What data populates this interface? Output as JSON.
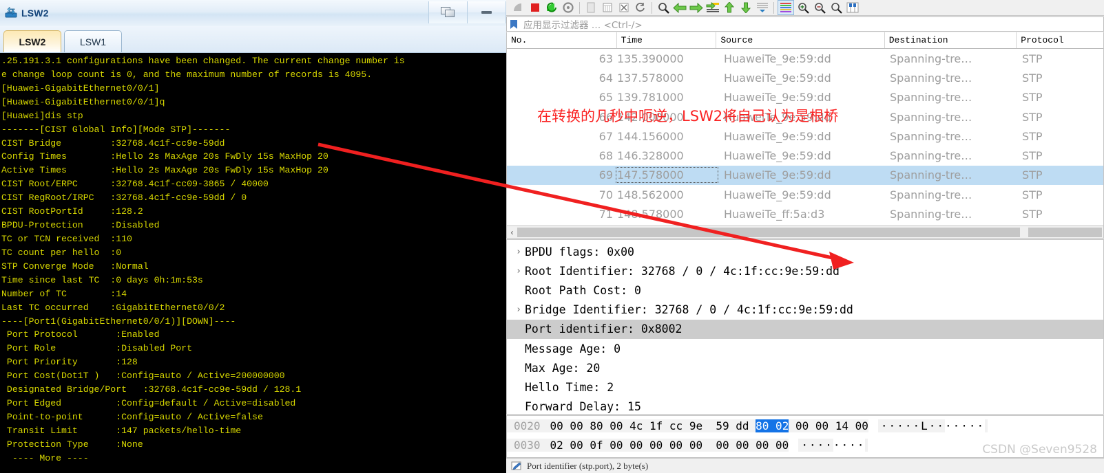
{
  "ensp": {
    "window_title": "LSW2",
    "icon": "switch-icon",
    "buttons": {
      "restore": "restore-icon",
      "minimize": "minimize-icon"
    },
    "tabs": [
      {
        "label": "LSW2",
        "active": true
      },
      {
        "label": "LSW1",
        "active": false
      }
    ],
    "console_text": ".25.191.3.1 configurations have been changed. The current change number is\ne change loop count is 0, and the maximum number of records is 4095.\n[Huawei-GigabitEthernet0/0/1]\n[Huawei-GigabitEthernet0/0/1]q\n[Huawei]dis stp\n-------[CIST Global Info][Mode STP]-------\nCIST Bridge         :32768.4c1f-cc9e-59dd\nConfig Times        :Hello 2s MaxAge 20s FwDly 15s MaxHop 20\nActive Times        :Hello 2s MaxAge 20s FwDly 15s MaxHop 20\nCIST Root/ERPC      :32768.4c1f-cc09-3865 / 40000\nCIST RegRoot/IRPC   :32768.4c1f-cc9e-59dd / 0\nCIST RootPortId     :128.2\nBPDU-Protection     :Disabled\nTC or TCN received  :110\nTC count per hello  :0\nSTP Converge Mode   :Normal\nTime since last TC  :0 days 0h:1m:53s\nNumber of TC        :14\nLast TC occurred    :GigabitEthernet0/0/2\n----[Port1(GigabitEthernet0/0/1)][DOWN]----\n Port Protocol       :Enabled\n Port Role           :Disabled Port\n Port Priority       :128\n Port Cost(Dot1T )   :Config=auto / Active=200000000\n Designated Bridge/Port   :32768.4c1f-cc9e-59dd / 128.1\n Port Edged          :Config=default / Active=disabled\n Point-to-point      :Config=auto / Active=false\n Transit Limit       :147 packets/hello-time\n Protection Type     :None\n  ---- More ----"
  },
  "wireshark": {
    "toolbar_icons": [
      "start-capture-icon",
      "stop-capture-icon",
      "restart-capture-icon",
      "capture-options-icon",
      "open-file-icon",
      "save-file-icon",
      "close-file-icon",
      "reload-file-icon",
      "find-packet-icon",
      "go-back-icon",
      "go-forward-icon",
      "go-to-packet-icon",
      "go-first-packet-icon",
      "go-last-packet-icon",
      "auto-scroll-icon",
      "colorize-packets-icon",
      "zoom-in-icon",
      "zoom-out-icon",
      "zoom-reset-icon",
      "resize-columns-icon"
    ],
    "filter": {
      "bookmark_icon": "filter-bookmark-icon",
      "placeholder": "应用显示过滤器 … <Ctrl-/>",
      "value": ""
    },
    "packet_list": {
      "columns": [
        "No.",
        "Time",
        "Source",
        "Destination",
        "Protocol"
      ],
      "rows": [
        {
          "no": "63",
          "time": "135.390000",
          "source": "HuaweiTe_9e:59:dd",
          "destination": "Spanning-tre…",
          "protocol": "STP",
          "selected": false
        },
        {
          "no": "64",
          "time": "137.578000",
          "source": "HuaweiTe_9e:59:dd",
          "destination": "Spanning-tre…",
          "protocol": "STP",
          "selected": false
        },
        {
          "no": "65",
          "time": "139.781000",
          "source": "HuaweiTe_9e:59:dd",
          "destination": "Spanning-tre…",
          "protocol": "STP",
          "selected": false
        },
        {
          "no": "66",
          "time": "142.000000",
          "source": "HuaweiTe_9e:59:dd",
          "destination": "Spanning-tre…",
          "protocol": "STP",
          "selected": false
        },
        {
          "no": "67",
          "time": "144.156000",
          "source": "HuaweiTe_9e:59:dd",
          "destination": "Spanning-tre…",
          "protocol": "STP",
          "selected": false
        },
        {
          "no": "68",
          "time": "146.328000",
          "source": "HuaweiTe_9e:59:dd",
          "destination": "Spanning-tre…",
          "protocol": "STP",
          "selected": false
        },
        {
          "no": "69",
          "time": "147.578000",
          "source": "HuaweiTe_9e:59:dd",
          "destination": "Spanning-tre…",
          "protocol": "STP",
          "selected": true
        },
        {
          "no": "70",
          "time": "148.562000",
          "source": "HuaweiTe_9e:59:dd",
          "destination": "Spanning-tre…",
          "protocol": "STP",
          "selected": false
        },
        {
          "no": "71",
          "time": "148.578000",
          "source": "HuaweiTe_ff:5a:d3",
          "destination": "Spanning-tre…",
          "protocol": "STP",
          "selected": false
        }
      ]
    },
    "packet_details": [
      {
        "text": "BPDU flags: 0x00",
        "expandable": true,
        "highlight": false
      },
      {
        "text": "Root Identifier: 32768 / 0 / 4c:1f:cc:9e:59:dd",
        "expandable": true,
        "highlight": false
      },
      {
        "text": "Root Path Cost: 0",
        "expandable": false,
        "highlight": false
      },
      {
        "text": "Bridge Identifier: 32768 / 0 / 4c:1f:cc:9e:59:dd",
        "expandable": true,
        "highlight": false
      },
      {
        "text": "Port identifier: 0x8002",
        "expandable": false,
        "highlight": true
      },
      {
        "text": "Message Age: 0",
        "expandable": false,
        "highlight": false
      },
      {
        "text": "Max Age: 20",
        "expandable": false,
        "highlight": false
      },
      {
        "text": "Hello Time: 2",
        "expandable": false,
        "highlight": false
      },
      {
        "text": "Forward Delay: 15",
        "expandable": false,
        "highlight": false
      }
    ],
    "hex_bytes": [
      {
        "offset": "0020",
        "pre": "00 00 80 00 4c 1f cc 9e  59 dd ",
        "sel": "80 02",
        "post": " 00 00 14 00",
        "ascii_pre": "·····L··",
        "ascii_post": "·····"
      },
      {
        "offset": "0030",
        "pre": "02 00 0f 00 ",
        "sel": "",
        "post": "00 00 00 00  00 00 00 00",
        "ascii_pre": "····",
        "ascii_post": "····"
      }
    ],
    "status_bar": {
      "icon": "packet-comment-icon",
      "text": "Port identifier (stp.port), 2 byte(s)"
    },
    "hscroll": {
      "name": "horizontal-scrollbar"
    }
  },
  "annotation": {
    "text": "在转换的几秒中呃逆，LSW2将自己认为是根桥",
    "color": "#fa2323",
    "arrow": "red-arrow"
  },
  "watermark": "CSDN @Seven9528"
}
